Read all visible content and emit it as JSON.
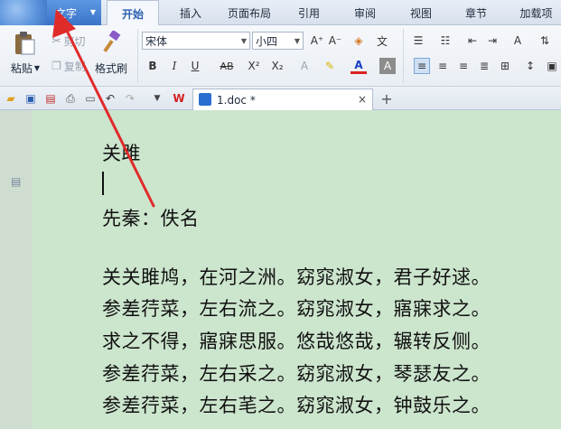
{
  "menubar": {
    "app_button": "文字",
    "tabs": [
      "开始",
      "插入",
      "页面布局",
      "引用",
      "审阅",
      "视图",
      "章节",
      "加载项"
    ],
    "active_tab": "开始"
  },
  "ribbon": {
    "paste": "粘贴",
    "cut": "剪切",
    "copy": "复制",
    "format_painter": "格式刷",
    "font_name": "宋体",
    "font_size": "小四",
    "bold": "B",
    "italic": "I",
    "underline": "U",
    "strike": "AB",
    "superscript": "X²",
    "subscript": "X₂",
    "font_color": "A",
    "grow_font": "A⁺",
    "shrink_font": "A⁻",
    "phonetic": "文"
  },
  "doc_tab": {
    "title": "1.doc *",
    "close": "×",
    "new": "+"
  },
  "document": {
    "lines": [
      "关雎",
      "",
      "先秦：佚名",
      "",
      "关关雎鸠，在河之洲。窈窕淑女，君子好逑。",
      "参差荇菜，左右流之。窈窕淑女，寤寐求之。",
      "求之不得，寤寐思服。悠哉悠哉，辗转反侧。",
      "参差荇菜，左右采之。窈窕淑女，琴瑟友之。",
      "参差荇菜，左右芼之。窈窕淑女，钟鼓乐之。"
    ]
  },
  "colors": {
    "accent": "#3a73c6",
    "page_bg": "#cce5cd",
    "arrow": "#e02b2b"
  }
}
